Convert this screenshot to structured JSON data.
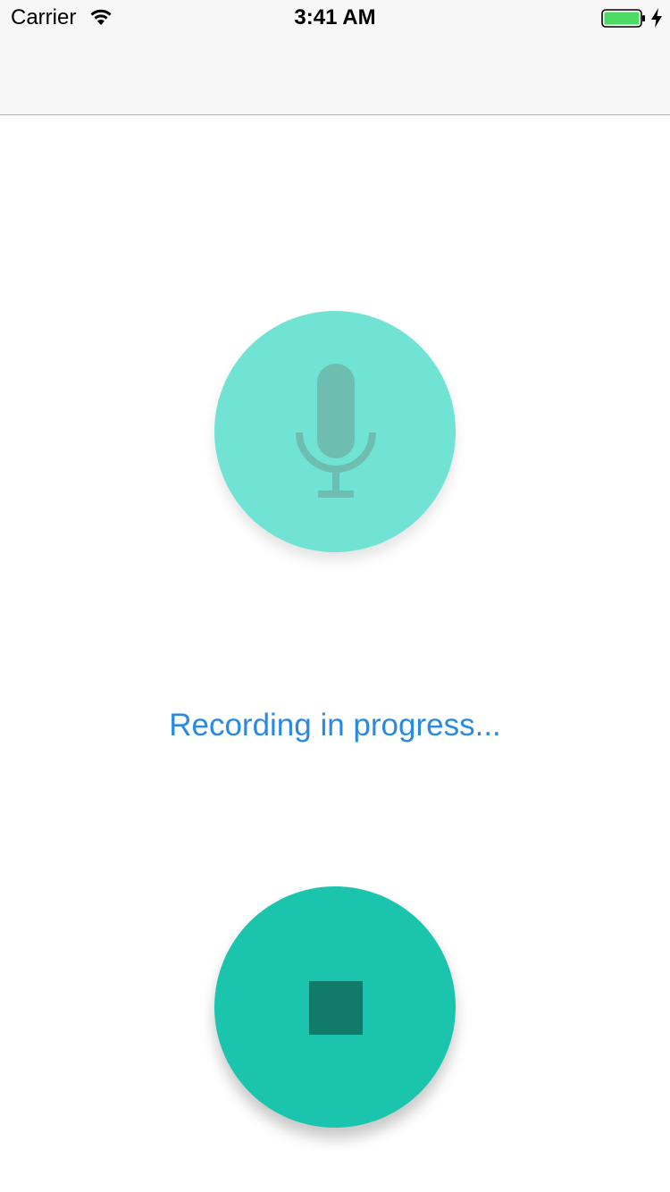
{
  "status_bar": {
    "carrier": "Carrier",
    "time": "3:41 AM",
    "wifi_icon": "wifi-icon",
    "battery_icon": "battery-icon",
    "charging_icon": "charging-bolt-icon",
    "battery_level": 1.0,
    "battery_color": "#4cd964"
  },
  "recorder": {
    "mic_icon": "microphone-icon",
    "mic_circle_color": "#70e3d4",
    "status_text": "Recording in progress...",
    "status_text_color": "#2a8ae0",
    "stop_icon": "stop-icon",
    "stop_button_color": "#1bc4ac"
  }
}
